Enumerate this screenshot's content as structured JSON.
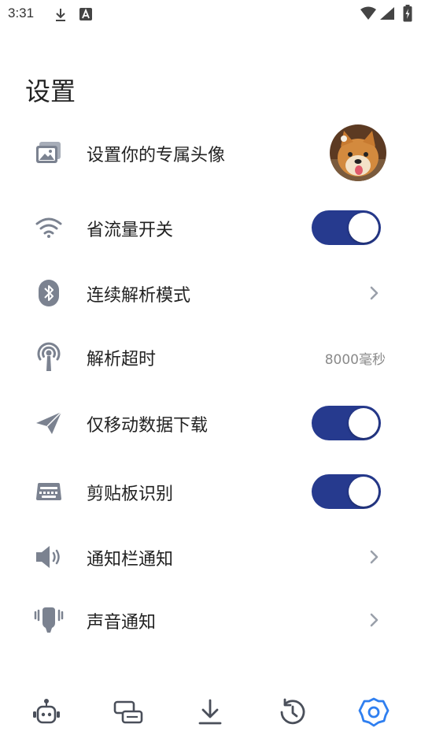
{
  "status_bar": {
    "time": "3:31",
    "icons": [
      "download-icon",
      "a-badge-icon",
      "wifi-icon",
      "signal-icon",
      "battery-icon"
    ]
  },
  "page": {
    "title": "设置"
  },
  "settings": [
    {
      "icon": "image-icon",
      "label": "设置你的专属头像",
      "control": "avatar"
    },
    {
      "icon": "wifi-icon",
      "label": "省流量开关",
      "control": "toggle",
      "on": true
    },
    {
      "icon": "bluetooth-icon",
      "label": "连续解析模式",
      "control": "chevron"
    },
    {
      "icon": "antenna-icon",
      "label": "解析超时",
      "control": "value",
      "value": "8000毫秒"
    },
    {
      "icon": "paper-plane-icon",
      "label": "仅移动数据下载",
      "control": "toggle",
      "on": true
    },
    {
      "icon": "keyboard-icon",
      "label": "剪贴板识别",
      "control": "toggle",
      "on": true
    },
    {
      "icon": "speaker-icon",
      "label": "通知栏通知",
      "control": "chevron"
    },
    {
      "icon": "vibrate-bell-icon",
      "label": "声音通知",
      "control": "chevron"
    }
  ],
  "bottom_nav": [
    {
      "icon": "robot-icon",
      "active": false
    },
    {
      "icon": "tasks-icon",
      "active": false
    },
    {
      "icon": "download-icon",
      "active": false
    },
    {
      "icon": "history-icon",
      "active": false
    },
    {
      "icon": "settings-gear-icon",
      "active": true
    }
  ],
  "colors": {
    "accent": "#263a8e",
    "icon_gray": "#7b8290",
    "nav_active": "#2f7ff0",
    "nav_inactive": "#4a4f5a",
    "text": "#222222",
    "secondary_text": "#8a8a8a"
  }
}
